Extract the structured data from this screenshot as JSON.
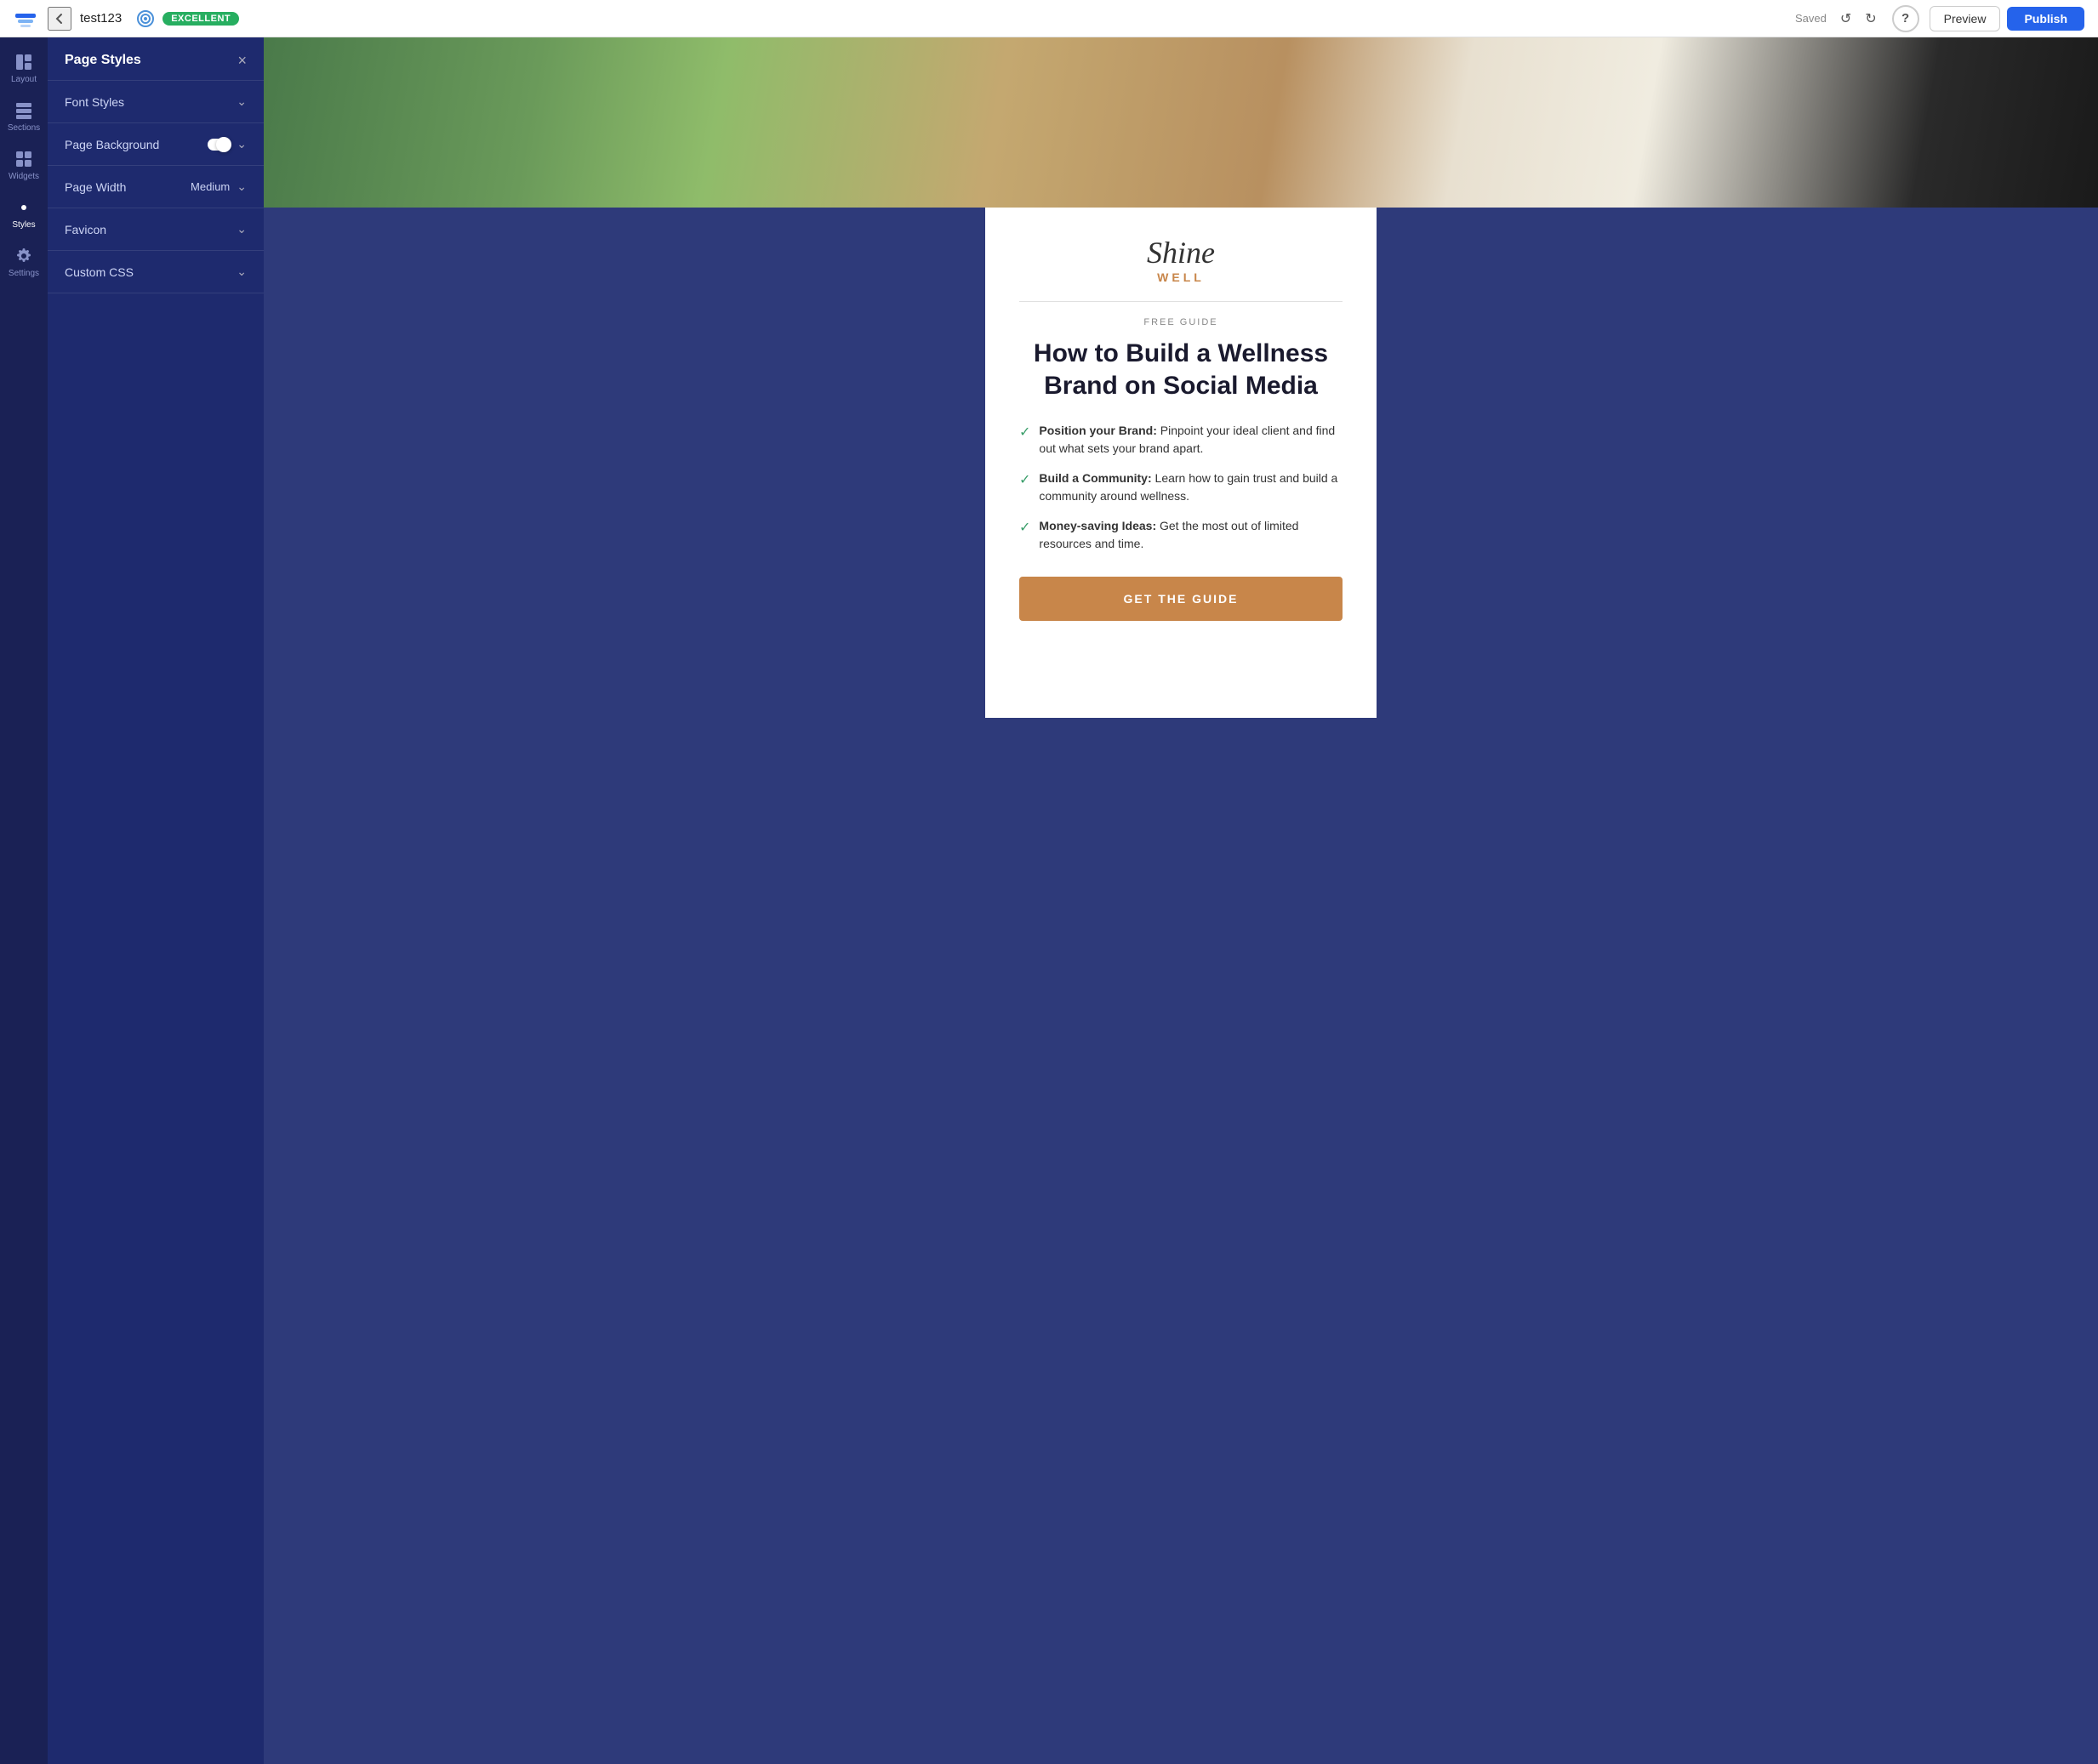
{
  "topbar": {
    "logo_alt": "Layers logo",
    "back_icon": "←",
    "title": "test123",
    "badge_label": "EXCELLENT",
    "saved_label": "Saved",
    "undo_icon": "↺",
    "redo_icon": "↻",
    "help_label": "?",
    "preview_label": "Preview",
    "publish_label": "Publish"
  },
  "icon_sidebar": {
    "items": [
      {
        "id": "layout",
        "label": "Layout",
        "active": false
      },
      {
        "id": "sections",
        "label": "Sections",
        "active": false
      },
      {
        "id": "widgets",
        "label": "Widgets",
        "active": false
      },
      {
        "id": "styles",
        "label": "Styles",
        "active": true
      },
      {
        "id": "settings",
        "label": "Settings",
        "active": false
      }
    ]
  },
  "panel": {
    "title": "Page Styles",
    "close_icon": "×",
    "sections": [
      {
        "id": "font-styles",
        "label": "Font Styles",
        "value": null,
        "has_toggle": false
      },
      {
        "id": "page-background",
        "label": "Page Background",
        "value": null,
        "has_toggle": true
      },
      {
        "id": "page-width",
        "label": "Page Width",
        "value": "Medium",
        "has_toggle": false
      },
      {
        "id": "favicon",
        "label": "Favicon",
        "value": null,
        "has_toggle": false
      },
      {
        "id": "custom-css",
        "label": "Custom CSS",
        "value": null,
        "has_toggle": false
      }
    ]
  },
  "landing_page": {
    "logo_script": "Shine",
    "logo_well": "WELL",
    "subtitle": "FREE GUIDE",
    "headline": "How to Build a Wellness Brand on Social Media",
    "checklist": [
      {
        "bold": "Position your Brand:",
        "text": " Pinpoint your ideal client and find out what sets your brand apart."
      },
      {
        "bold": "Build a Community:",
        "text": " Learn how to gain trust and build a community around wellness."
      },
      {
        "bold": "Money-saving Ideas:",
        "text": " Get the most out of limited resources and time."
      }
    ],
    "cta_label": "GET THE GUIDE"
  },
  "colors": {
    "sidebar_bg": "#1a2155",
    "panel_bg": "#1e2a6e",
    "content_bg": "#2e3a7a",
    "accent_blue": "#2563eb",
    "badge_green": "#27ae60",
    "cta_orange": "#c8864a",
    "check_green": "#3a9e6a"
  }
}
